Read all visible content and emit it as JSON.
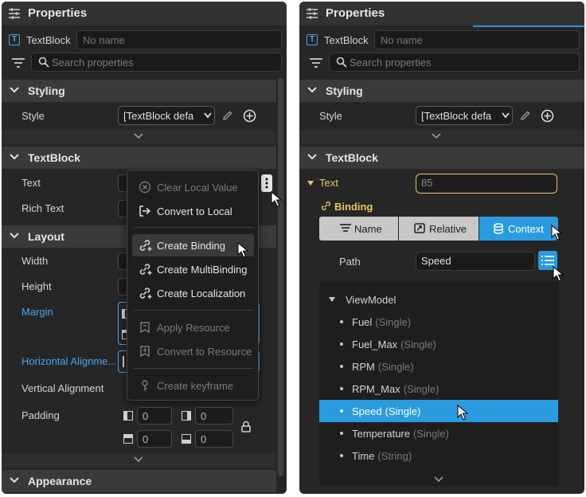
{
  "left_panel": {
    "title": "Properties",
    "element_type": "TextBlock",
    "name_placeholder": "No name",
    "search_placeholder": "Search properties",
    "sections": {
      "styling": "Styling",
      "textblock": "TextBlock",
      "layout": "Layout",
      "appearance": "Appearance"
    },
    "labels": {
      "style": "Style",
      "text": "Text",
      "rich_text": "Rich Text",
      "width": "Width",
      "height": "Height",
      "margin": "Margin",
      "horizontal_alignment": "Horizontal Alignme...",
      "vertical_alignment": "Vertical Alignment",
      "padding": "Padding"
    },
    "style_value": "[TextBlock defa",
    "padding_values": [
      "0",
      "0",
      "0",
      "0"
    ],
    "context_menu": [
      {
        "label": "Clear Local Value",
        "enabled": false,
        "icon": "clear-circle-icon"
      },
      {
        "label": "Convert to Local",
        "enabled": true,
        "icon": "convert-arrow-icon"
      },
      {
        "label": "Create Binding",
        "enabled": true,
        "icon": "link-plus-icon",
        "hovered": true
      },
      {
        "label": "Create MultiBinding",
        "enabled": true,
        "icon": "multi-link-icon"
      },
      {
        "label": "Create Localization",
        "enabled": true,
        "icon": "localization-icon"
      },
      {
        "label": "Apply Resource",
        "enabled": false,
        "icon": "resource-icon"
      },
      {
        "label": "Convert to Resource",
        "enabled": false,
        "icon": "resource-add-icon"
      },
      {
        "label": "Create keyframe",
        "enabled": false,
        "icon": "keyframe-icon"
      }
    ]
  },
  "right_panel": {
    "title": "Properties",
    "element_type": "TextBlock",
    "name_placeholder": "No name",
    "search_placeholder": "Search properties",
    "sections": {
      "styling": "Styling",
      "textblock": "TextBlock"
    },
    "labels": {
      "style": "Style",
      "text": "Text",
      "binding": "Binding",
      "path": "Path"
    },
    "style_value": "[TextBlock defa",
    "text_value": "85",
    "binding_modes": [
      {
        "label": "Name",
        "active": false
      },
      {
        "label": "Relative",
        "active": false
      },
      {
        "label": "Context",
        "active": true
      }
    ],
    "path_value": "Speed",
    "tree": {
      "root": "ViewModel",
      "items": [
        {
          "name": "Fuel",
          "type": "(Single)"
        },
        {
          "name": "Fuel_Max",
          "type": "(Single)"
        },
        {
          "name": "RPM",
          "type": "(Single)"
        },
        {
          "name": "RPM_Max",
          "type": "(Single)"
        },
        {
          "name": "Speed",
          "type": "(Single)",
          "selected": true
        },
        {
          "name": "Temperature",
          "type": "(Single)"
        },
        {
          "name": "Time",
          "type": "(String)"
        }
      ]
    }
  },
  "colors": {
    "panel_bg": "#262626",
    "section_bg": "#3a3a3a",
    "accent_blue": "#2b9be0",
    "link_blue": "#4aa3ec",
    "bound_gold": "#e9c46a"
  }
}
